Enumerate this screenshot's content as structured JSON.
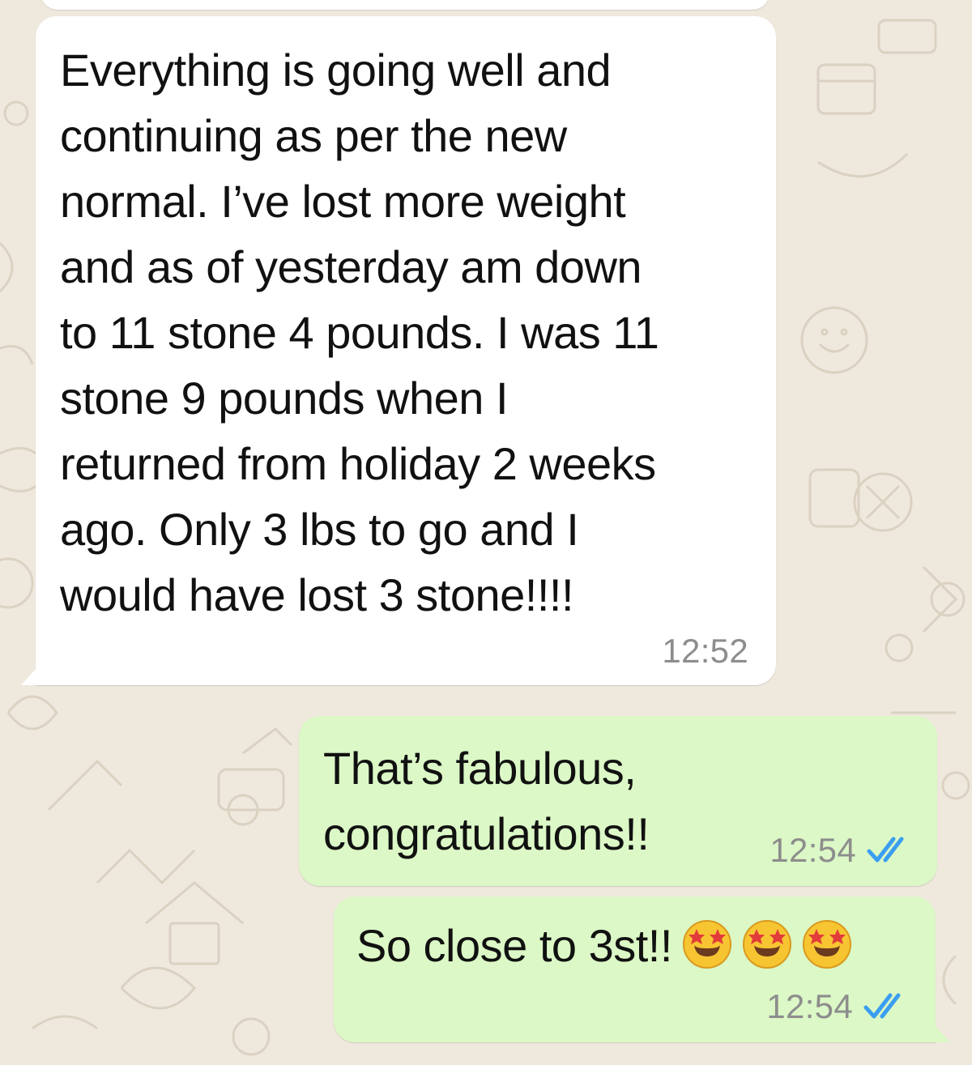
{
  "chat": {
    "wallpaper_color": "#efe8dd",
    "incoming_bubble_color": "#ffffff",
    "outgoing_bubble_color": "#dbf8c6",
    "read_receipt_color": "#3a9ef0",
    "messages": [
      {
        "direction": "incoming",
        "text": "Everything is going well and\ncontinuing as per the new\nnormal. I’ve lost more weight\nand as of yesterday am down\nto 11 stone 4 pounds. I was 11\nstone 9 pounds when I\nreturned from holiday 2 weeks\nago. Only 3 lbs to go and I\nwould have lost 3 stone!!!!",
        "time": "12:52"
      },
      {
        "direction": "outgoing",
        "text": "That’s fabulous,\ncongratulations!!",
        "time": "12:54",
        "status_icon": "double-check-read-icon"
      },
      {
        "direction": "outgoing",
        "text": "So close to 3st!!",
        "emojis": [
          "star-struck-emoji-icon",
          "star-struck-emoji-icon",
          "star-struck-emoji-icon"
        ],
        "time": "12:54",
        "status_icon": "double-check-read-icon"
      }
    ]
  }
}
